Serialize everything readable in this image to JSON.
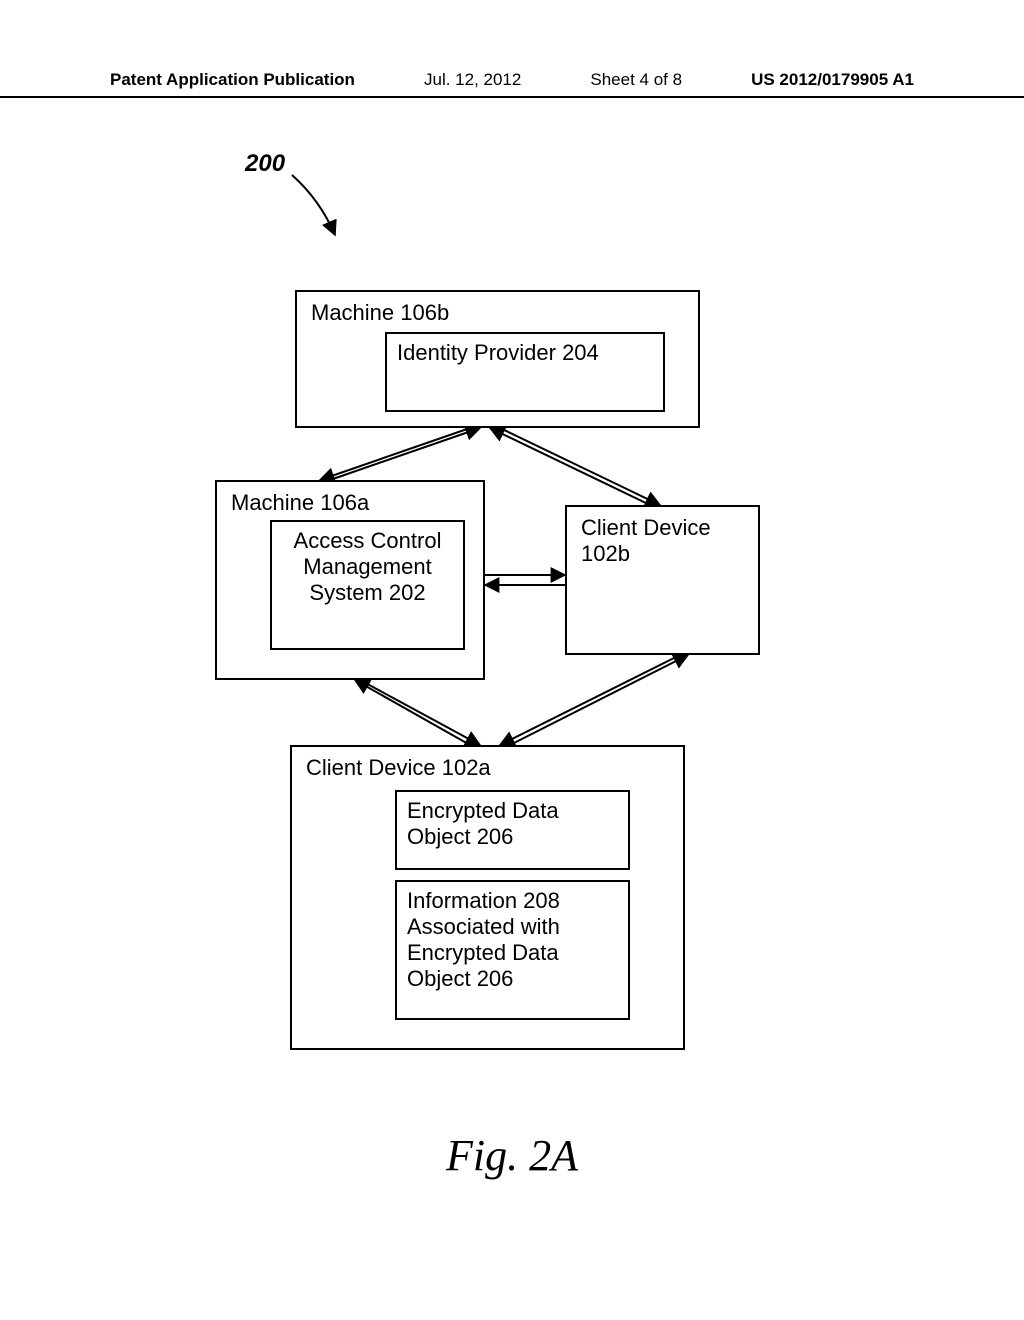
{
  "header": {
    "publication": "Patent Application Publication",
    "date": "Jul. 12, 2012",
    "sheet": "Sheet 4 of 8",
    "number": "US 2012/0179905 A1"
  },
  "figureRef": "200",
  "boxes": {
    "m106b": {
      "label": "Machine 106b"
    },
    "idp": {
      "text": "Identity Provider 204"
    },
    "m106a": {
      "label": "Machine 106a"
    },
    "acms": {
      "text": "Access Control Management System 202"
    },
    "cd102b": {
      "label": "Client Device 102b"
    },
    "cd102a": {
      "label": "Client Device 102a"
    },
    "edo": {
      "text": "Encrypted Data Object 206"
    },
    "info": {
      "text": "Information 208 Associated with Encrypted Data Object 206"
    }
  },
  "caption": "Fig. 2A"
}
